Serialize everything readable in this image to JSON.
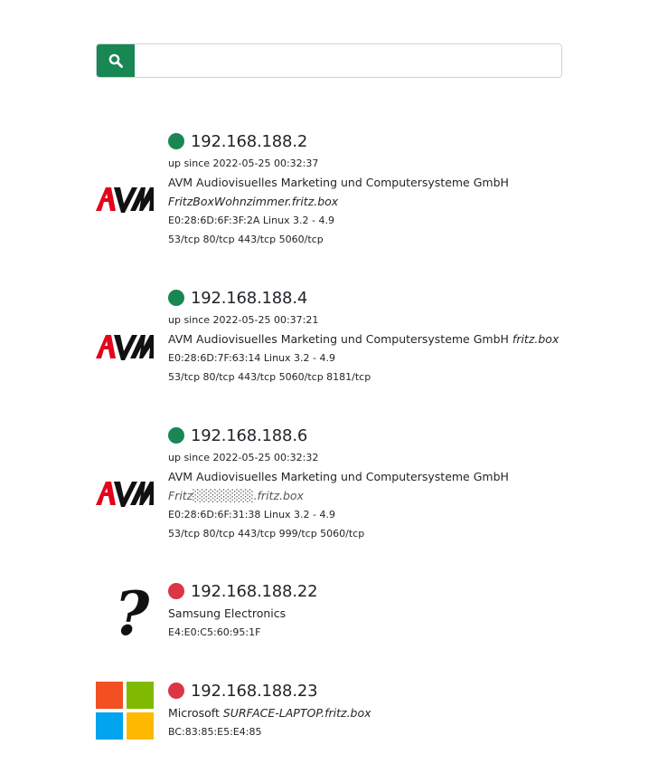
{
  "search": {
    "placeholder": "",
    "value": "",
    "icon": "search-icon",
    "button_color": "#198754"
  },
  "status_colors": {
    "up": "#198754",
    "down": "#dc3545"
  },
  "devices": [
    {
      "ip": "192.168.188.2",
      "status": "up",
      "logo": "avm-logo",
      "up_since": "up since 2022-05-25 00:32:37",
      "vendor": "AVM Audiovisuelles Marketing und Computersysteme GmbH",
      "hostname": "FritzBoxWohnzimmer.fritz.box",
      "mac_os": "E0:28:6D:6F:3F:2A Linux 3.2 - 4.9",
      "ports": "53/tcp 80/tcp 443/tcp 5060/tcp"
    },
    {
      "ip": "192.168.188.4",
      "status": "up",
      "logo": "avm-logo",
      "up_since": "up since 2022-05-25 00:37:21",
      "vendor": "AVM Audiovisuelles Marketing und Computersysteme GmbH",
      "hostname": "fritz.box",
      "mac_os": "E0:28:6D:7F:63:14 Linux 3.2 - 4.9",
      "ports": "53/tcp 80/tcp 443/tcp 5060/tcp 8181/tcp"
    },
    {
      "ip": "192.168.188.6",
      "status": "up",
      "logo": "avm-logo",
      "up_since": "up since 2022-05-25 00:32:32",
      "vendor": "AVM Audiovisuelles Marketing und Computersysteme GmbH",
      "hostname": "Fritz░░░░░░░.fritz.box",
      "mac_os": "E0:28:6D:6F:31:38 Linux 3.2 - 4.9",
      "ports": "53/tcp 80/tcp 443/tcp 999/tcp 5060/tcp"
    },
    {
      "ip": "192.168.188.22",
      "status": "down",
      "logo": "question-mark-icon",
      "vendor": "Samsung Electronics",
      "mac": "E4:E0:C5:60:95:1F"
    },
    {
      "ip": "192.168.188.23",
      "status": "down",
      "logo": "microsoft-logo",
      "vendor": "Microsoft",
      "hostname": "SURFACE-LAPTOP.fritz.box",
      "mac": "BC:83:85:E5:E4:85"
    }
  ]
}
